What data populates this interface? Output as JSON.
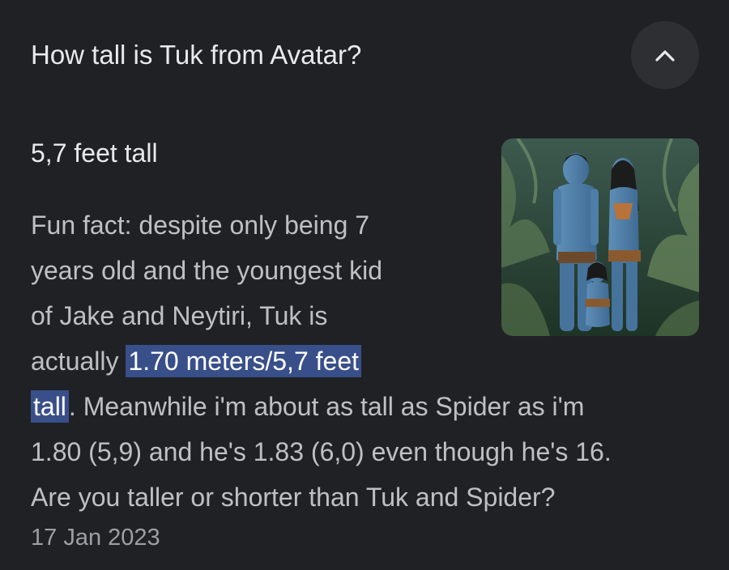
{
  "question": {
    "title": "How tall is Tuk from Avatar?",
    "collapse_icon": "chevron-up-icon"
  },
  "answer": {
    "short": "5,7 feet tall",
    "lines": [
      "Fun fact: despite only being 7",
      "years old and the youngest kid",
      "of Jake and Neytiri, Tuk is"
    ],
    "line4_prefix": "actually ",
    "highlight_part1": "1.70 meters/5,7 feet",
    "highlight_part2": "tall",
    "line5_rest": ". Meanwhile i'm about as tall as Spider as i'm",
    "line6": "1.80 (5,9) and he's 1.83 (6,0) even though he's 16.",
    "line7": "Are you taller or shorter than Tuk and Spider?",
    "date": "17 Jan 2023"
  },
  "thumbnail": {
    "icon": "avatar-family-image"
  },
  "colors": {
    "background": "#202124",
    "text": "#e8eaed",
    "highlight": "#394f8a",
    "muted": "#9aa0a6"
  }
}
